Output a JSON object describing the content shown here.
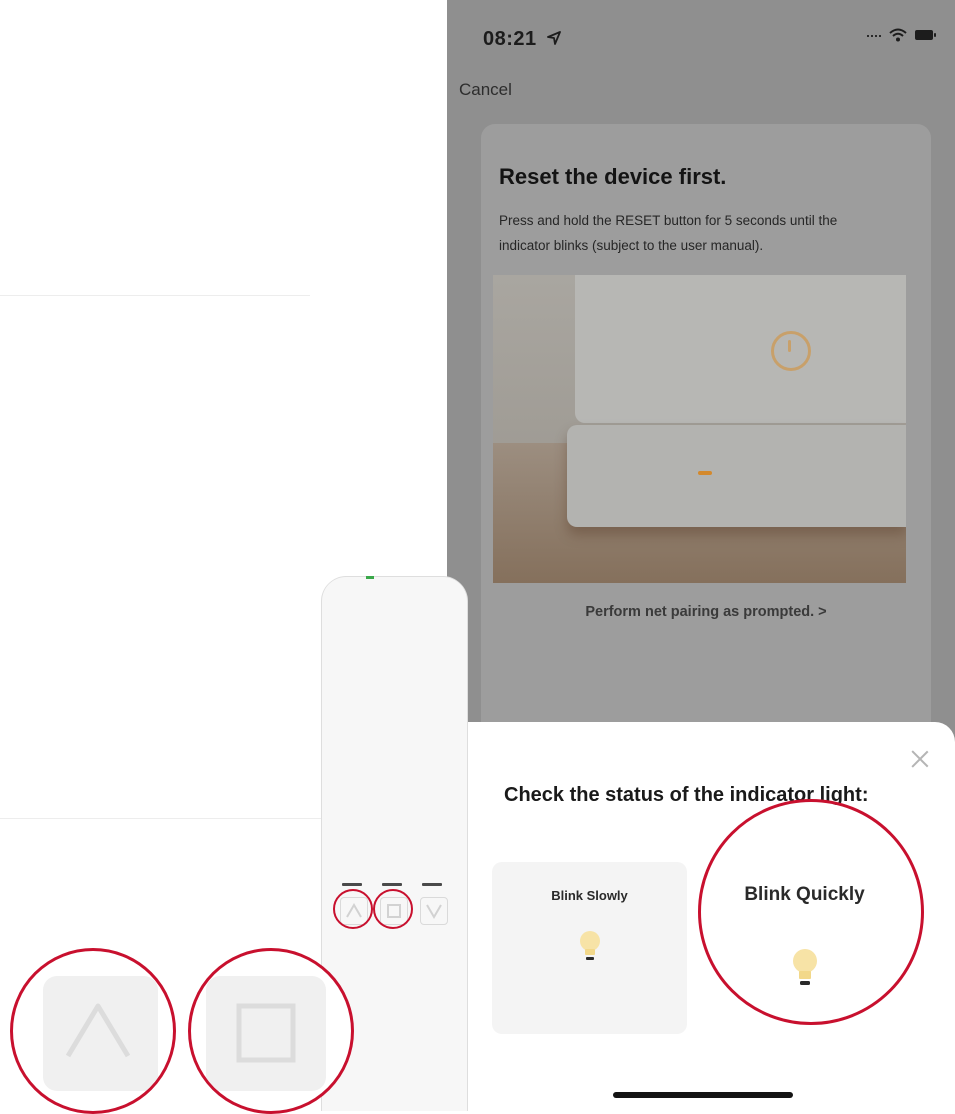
{
  "status_bar": {
    "time": "08:21"
  },
  "nav": {
    "cancel_label": "Cancel"
  },
  "card": {
    "title": "Reset the device first.",
    "description": "Press and hold the RESET button for 5 seconds until the indicator blinks (subject to the user manual).",
    "pairing_link": "Perform net pairing as prompted. >"
  },
  "sheet": {
    "title": "Check the status of the indicator light:",
    "options": [
      {
        "label": "Blink Slowly"
      },
      {
        "label": "Blink Quickly"
      }
    ]
  },
  "colors": {
    "highlight": "#c8102e",
    "led": "#d4892c",
    "bulb": "#f7e3a6"
  },
  "icons": {
    "status": [
      "location-arrow-icon",
      "wifi-icon",
      "battery-icon"
    ],
    "device": [
      "power-button-icon"
    ],
    "remote": [
      "up-arrow-icon",
      "stop-icon",
      "down-arrow-icon"
    ],
    "sheet": [
      "close-icon",
      "bulb-icon"
    ]
  }
}
